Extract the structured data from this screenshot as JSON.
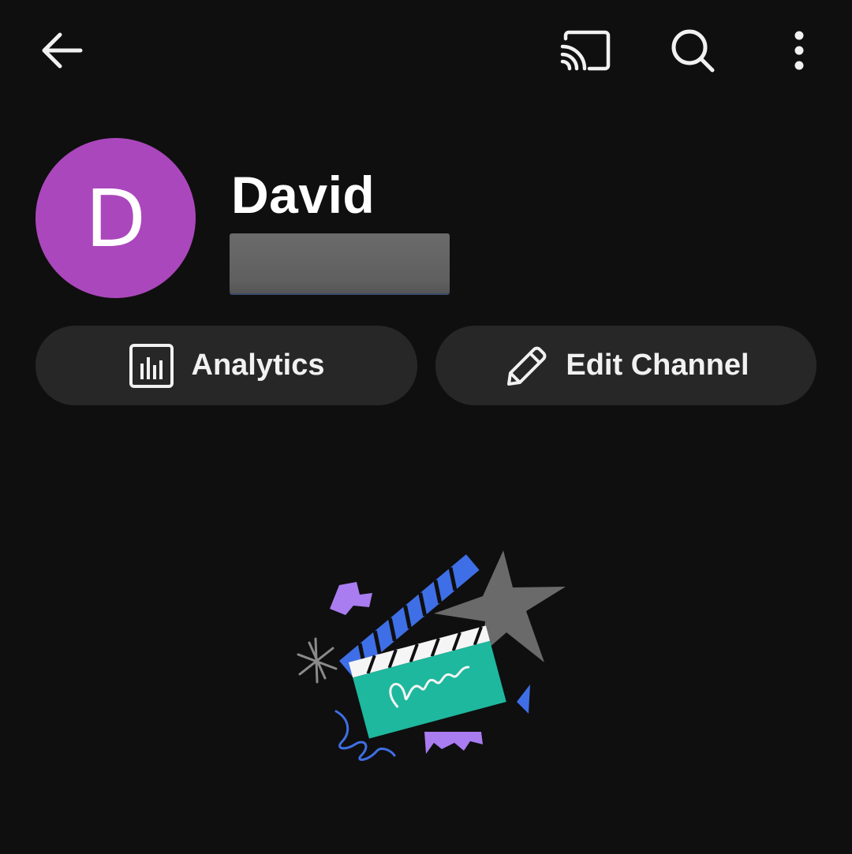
{
  "topbar": {
    "back_icon": "arrow-back-icon",
    "cast_icon": "cast-icon",
    "search_icon": "search-icon",
    "more_icon": "more-vert-icon"
  },
  "channel": {
    "avatar_initial": "D",
    "avatar_color": "#ab47bc",
    "name": "David"
  },
  "actions": {
    "analytics_label": "Analytics",
    "analytics_icon": "analytics-icon",
    "edit_label": "Edit Channel",
    "edit_icon": "pencil-icon"
  },
  "colors": {
    "background": "#0f0f0f",
    "pill": "#272727",
    "text": "#f1f1f1"
  }
}
